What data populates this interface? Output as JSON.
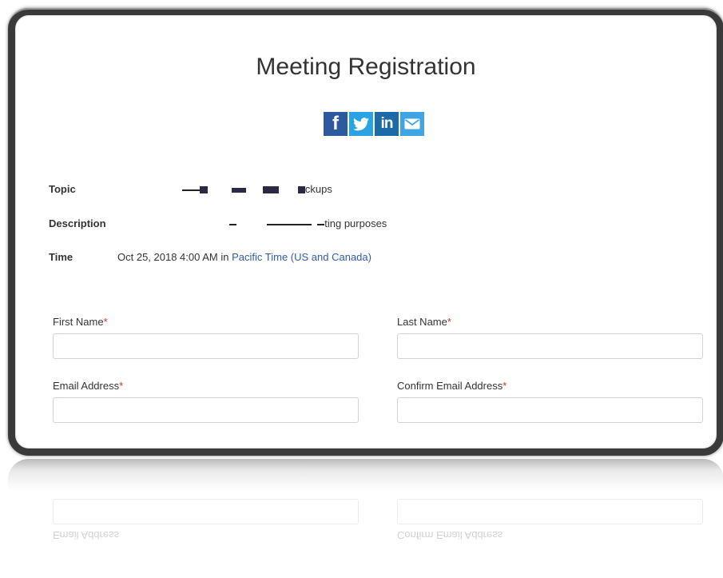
{
  "page": {
    "title": "Meeting Registration"
  },
  "share": [
    {
      "name": "facebook-icon",
      "glyph": "f"
    },
    {
      "name": "twitter-icon",
      "glyph": "🐦"
    },
    {
      "name": "linkedin-icon",
      "glyph": "in"
    },
    {
      "name": "email-icon",
      "glyph": "✉"
    }
  ],
  "info": {
    "topic_label": "Topic",
    "topic_visible": "ckups",
    "description_label": "Description",
    "description_visible": "ting purposes",
    "time_label": "Time",
    "time_value": "Oct 25, 2018 4:00 AM in",
    "timezone_link": "Pacific Time (US and Canada)"
  },
  "form": {
    "required_mark": "*",
    "first_name_label": "First Name",
    "last_name_label": "Last Name",
    "email_label": "Email Address",
    "confirm_email_label": "Confirm Email Address",
    "first_name_value": "",
    "last_name_value": "",
    "email_value": "",
    "confirm_email_value": ""
  },
  "colors": {
    "frame": "#3a3a3a",
    "required": "#c0392b",
    "link": "#2f5ca8",
    "facebook": "#2d5a9e",
    "twitter": "#2aa3e4",
    "linkedin": "#1c6aa8",
    "email": "#3fa4e4"
  }
}
